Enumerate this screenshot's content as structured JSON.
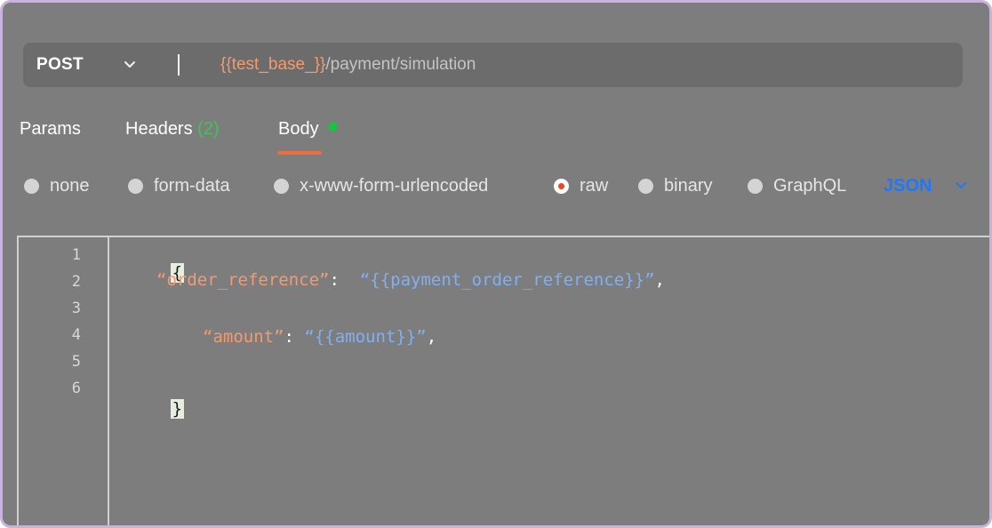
{
  "request": {
    "method": "POST",
    "url_variable": "{{test_base_}}",
    "url_path": "/payment/simulation"
  },
  "tabs": [
    {
      "label": "Params"
    },
    {
      "label": "Headers",
      "count": "(2)"
    },
    {
      "label": "Body",
      "active": true
    }
  ],
  "body_types": [
    {
      "label": "none",
      "selected": false
    },
    {
      "label": "form-data",
      "selected": false
    },
    {
      "label": "x-www-form-urlencoded",
      "selected": false
    },
    {
      "label": "raw",
      "selected": true
    },
    {
      "label": "binary",
      "selected": false
    },
    {
      "label": "GraphQL",
      "selected": false
    }
  ],
  "language": "JSON",
  "editor": {
    "line_numbers": [
      "1",
      "2",
      "3",
      "4",
      "5",
      "6"
    ],
    "open_brace": "{",
    "close_brace": "}",
    "lines": [
      {
        "key": "“order_reference”",
        "colon": ":",
        "value": "“{{payment_order_reference}}”",
        "comma": ","
      },
      {
        "key": "“amount”",
        "colon": ":",
        "value": "“{{amount}}”",
        "comma": ","
      }
    ]
  },
  "colors": {
    "accent_orange": "#f26b3a",
    "variable_orange": "#f29a70",
    "string_blue": "#7eb0f5",
    "link_blue": "#1e78ff",
    "status_green": "#1fbf3f"
  },
  "icons": {
    "method_dropdown": "chevron-down-icon",
    "language_dropdown": "chevron-down-icon"
  }
}
